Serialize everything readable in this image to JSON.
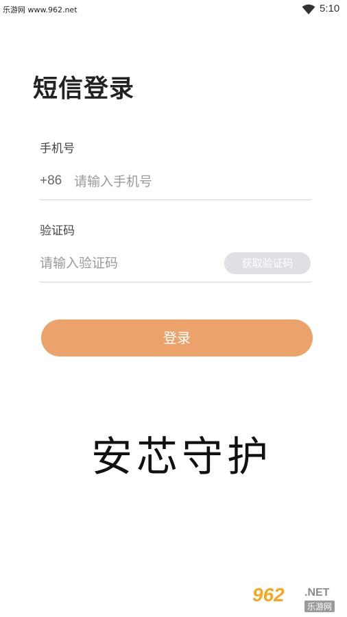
{
  "status_bar": {
    "site_label": "乐游网 www.962.net",
    "time": "5:10",
    "wifi_icon": "wifi-icon"
  },
  "page": {
    "title": "短信登录"
  },
  "phone": {
    "label": "手机号",
    "country_code": "+86",
    "placeholder": "请输入手机号",
    "value": ""
  },
  "code": {
    "label": "验证码",
    "placeholder": "请输入验证码",
    "value": "",
    "get_code_label": "获取验证码"
  },
  "login": {
    "label": "登录",
    "color": "#eba36b"
  },
  "brand": {
    "text": "安芯守护"
  },
  "watermark": {
    "main": "962",
    "ext": ".NET",
    "sub": "乐游网"
  }
}
